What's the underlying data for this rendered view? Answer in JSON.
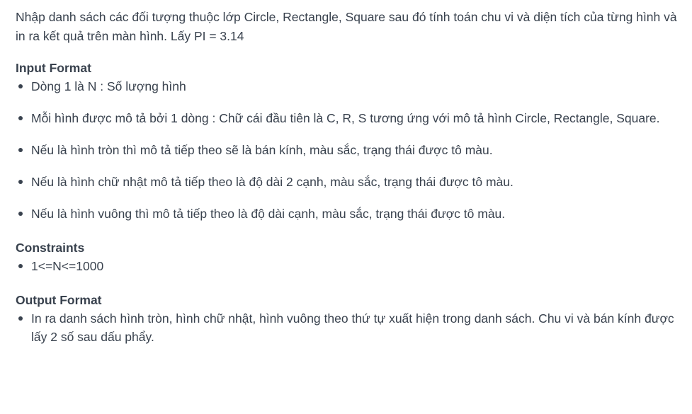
{
  "intro": "Nhập danh sách các đối tượng thuộc lớp Circle, Rectangle, Square sau đó tính toán chu vi và diện tích của từng hình và in ra kết quả trên màn hình. Lấy PI = 3.14",
  "input_format": {
    "heading": "Input Format",
    "items": [
      "Dòng 1 là N : Số lượng hình",
      "Mỗi hình được mô tả bởi 1 dòng : Chữ cái đầu tiên là C, R, S tương ứng với mô tả hình Circle, Rectangle, Square.",
      "Nếu là hình tròn thì mô tả tiếp theo sẽ là bán kính, màu sắc, trạng thái được tô màu.",
      "Nếu là hình chữ nhật mô tả tiếp theo là độ dài 2 cạnh, màu sắc, trạng thái được tô màu.",
      "Nếu là hình vuông thì mô tả tiếp theo là độ dài cạnh, màu sắc, trạng thái được tô màu."
    ]
  },
  "constraints": {
    "heading": "Constraints",
    "items": [
      "1<=N<=1000"
    ]
  },
  "output_format": {
    "heading": "Output Format",
    "items": [
      "In ra danh sách hình tròn, hình chữ nhật, hình vuông theo thứ tự xuất hiện trong danh sách. Chu vi và bán kính được lấy 2 số sau dấu phẩy."
    ]
  }
}
